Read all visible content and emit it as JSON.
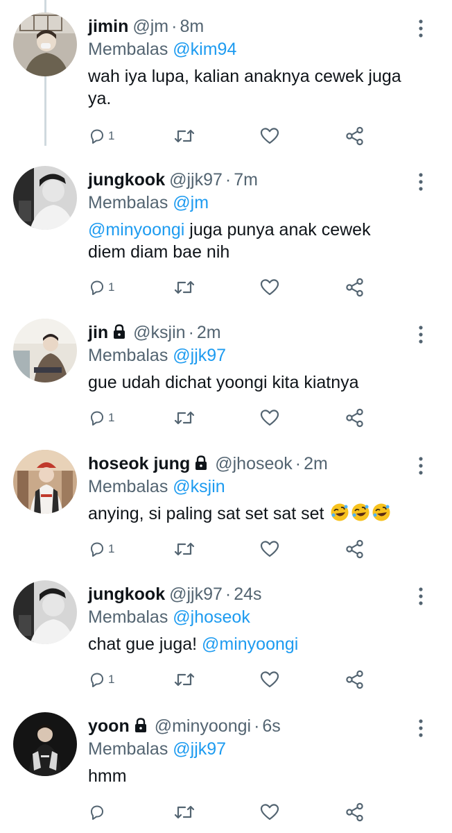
{
  "colors": {
    "link": "#1d9bf0",
    "muted": "#536471",
    "text": "#0f1419",
    "thread_line": "#cfd9de"
  },
  "icons": {
    "reply": "reply-icon",
    "retweet": "retweet-icon",
    "like": "heart-icon",
    "share": "share-icon",
    "more": "more-vertical-icon",
    "lock": "lock-icon"
  },
  "tweets": [
    {
      "name": "jimin",
      "handle": "@jm",
      "dot": "·",
      "time": "8m",
      "reply_prefix": "Membalas",
      "reply_to": "@kim94",
      "text": "wah iya lupa, kalian anaknya cewek juga ya.",
      "reply_count": "1"
    },
    {
      "name": "jungkook",
      "handle": "@jjk97",
      "dot": "·",
      "time": "7m",
      "reply_prefix": "Membalas",
      "reply_to": "@jm",
      "text_mention": "@minyoongi",
      "text_line1_rest": " juga punya anak cewek",
      "text_line2": "diem diam bae nih",
      "reply_count": "1"
    },
    {
      "name": "jin",
      "handle": "@ksjin",
      "dot": "·",
      "time": "2m",
      "reply_prefix": "Membalas",
      "reply_to": "@jjk97",
      "text": "gue udah dichat yoongi kita kiatnya",
      "reply_count": "1"
    },
    {
      "name": "hoseok jung",
      "handle": "@jhoseok",
      "dot": "·",
      "time": "2m",
      "reply_prefix": "Membalas",
      "reply_to": "@ksjin",
      "text": "anying, si paling sat set sat set",
      "reply_count": "1"
    },
    {
      "name": "jungkook",
      "handle": "@jjk97",
      "dot": "·",
      "time": "24s",
      "reply_prefix": "Membalas",
      "reply_to": "@jhoseok",
      "text": "chat gue juga! ",
      "text_mention": "@minyoongi",
      "reply_count": "1"
    },
    {
      "name": "yoon",
      "handle": "@minyoongi",
      "dot": "·",
      "time": "6s",
      "reply_prefix": "Membalas",
      "reply_to": "@jjk97",
      "text": "hmm",
      "reply_count": ""
    }
  ]
}
